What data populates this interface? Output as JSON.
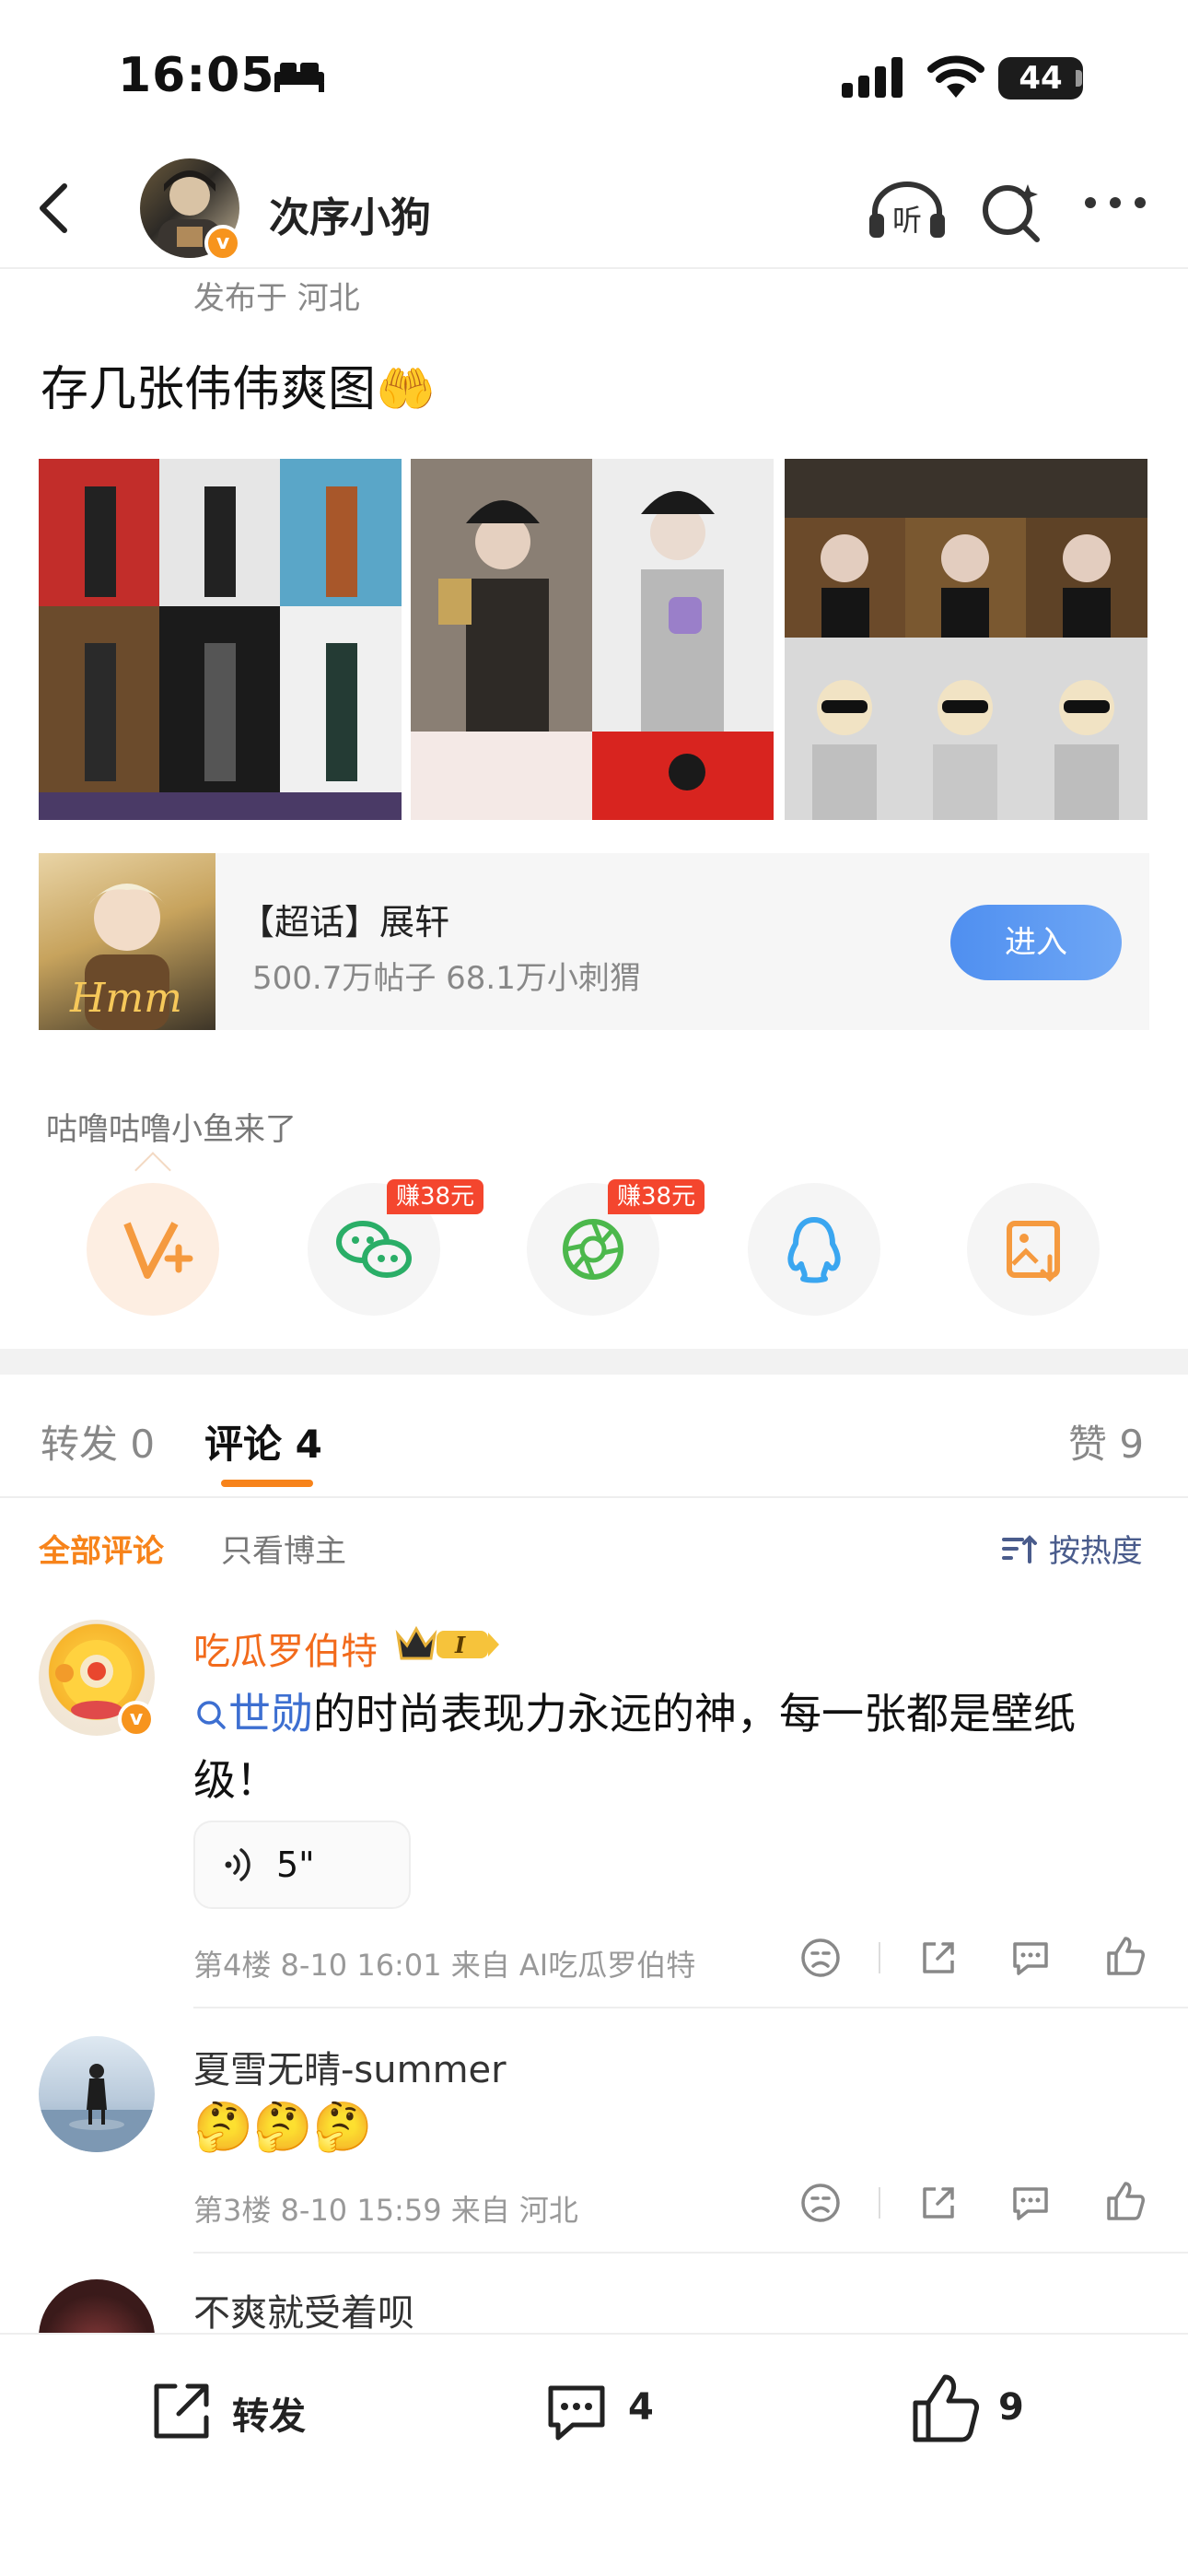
{
  "status_bar": {
    "time": "16:05",
    "battery": "44"
  },
  "header": {
    "username": "次序小狗",
    "verified_badge": "v",
    "back_icon": "chevron-left-icon",
    "listen_icon": "headphones-listen-icon",
    "listen_label": "听",
    "search_icon": "search-sparkle-icon",
    "more_icon": "more-dots-icon"
  },
  "post": {
    "published_from": "发布于 河北",
    "text": "存几张伟伟爽图",
    "emoji": "🤲"
  },
  "supertopic_card": {
    "title": "【超话】展轩",
    "stats": "500.7万帖子 68.1万小刺猬",
    "enter_label": "进入",
    "image_text": "Hmm"
  },
  "share": {
    "title": "咕噜咕噜小鱼来了",
    "items": [
      {
        "icon": "v-plus-icon",
        "badge": ""
      },
      {
        "icon": "wechat-icon",
        "badge": "赚38元"
      },
      {
        "icon": "moments-icon",
        "badge": "赚38元"
      },
      {
        "icon": "qq-icon",
        "badge": ""
      },
      {
        "icon": "save-image-icon",
        "badge": ""
      }
    ]
  },
  "tabs": {
    "repost": "转发 0",
    "comment": "评论 4",
    "like": "赞 9"
  },
  "filters": {
    "all": "全部评论",
    "owner_only": "只看博主",
    "sort": "按热度"
  },
  "comments": [
    {
      "name": "吃瓜罗伯特",
      "topic": "世勋",
      "text": "的时尚表现力永远的神，每一张都是壁纸级！",
      "voice_length": "5\"",
      "meta": "第4楼 8-10 16:01 来自 AI吃瓜罗伯特"
    },
    {
      "name": "夏雪无晴-summer",
      "emojis": "🤔🤔🤔",
      "meta": "第3楼 8-10 15:59 来自 河北"
    },
    {
      "name": "不爽就受着呗"
    }
  ],
  "bottom_bar": {
    "repost": "转发",
    "comment_count": "4",
    "like_count": "9"
  },
  "colors": {
    "accent": "#f7831a",
    "topic_blue": "#3d6fd1",
    "enter_button": "#5b97f2",
    "name_orange": "#f26a1b"
  }
}
